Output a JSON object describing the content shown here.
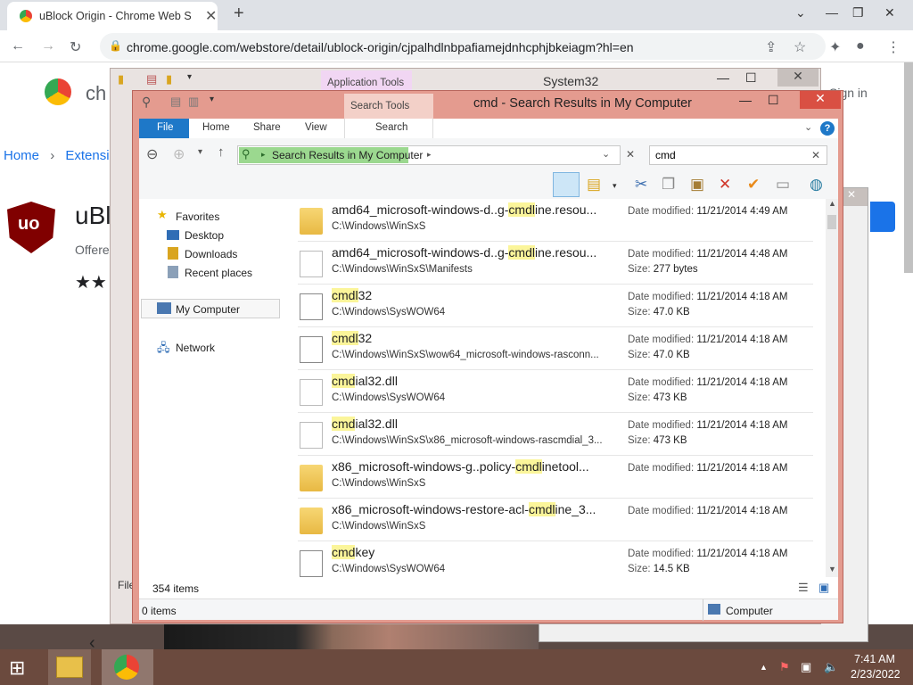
{
  "browser": {
    "tab_title": "uBlock Origin - Chrome Web Store",
    "new_tab_icon": "+",
    "url": "chrome.google.com/webstore/detail/ublock-origin/cjpalhdlnbpafiamejdnhcphjbkeiagm?hl=en"
  },
  "webpage": {
    "store_title_partial": "ch",
    "sign_in": "Sign in",
    "breadcrumb_home": "Home",
    "breadcrumb_sep": "›",
    "breadcrumb_ext": "Extensi",
    "ext_name_partial": "uBl",
    "ext_logo_text": "uo",
    "offered_partial": "Offere",
    "stars": "★★"
  },
  "background_window": {
    "title": "System32",
    "context_tab": "Application Tools",
    "status_partial": "File"
  },
  "explorer": {
    "title": "cmd - Search Results in My Computer",
    "context_tab": "Search Tools",
    "ribbon_tabs": {
      "file": "File",
      "home": "Home",
      "share": "Share",
      "view": "View",
      "search": "Search"
    },
    "address": "Search Results in My Computer",
    "search_value": "cmd",
    "nav": {
      "favorites": "Favorites",
      "desktop": "Desktop",
      "downloads": "Downloads",
      "recent": "Recent places",
      "my_computer": "My Computer",
      "network": "Network"
    },
    "date_label": "Date modified:",
    "size_label": "Size:",
    "results": [
      {
        "pre": "amd64_microsoft-windows-d..g-",
        "hit": "cmdl",
        "post": "ine.resou...",
        "path": "C:\\Windows\\WinSxS",
        "date": "11/21/2014 4:49 AM",
        "size": "",
        "icon": "folder"
      },
      {
        "pre": "amd64_microsoft-windows-d..g-",
        "hit": "cmdl",
        "post": "ine.resou...",
        "path": "C:\\Windows\\WinSxS\\Manifests",
        "date": "11/21/2014 4:48 AM",
        "size": "277 bytes",
        "icon": "document"
      },
      {
        "pre": "",
        "hit": "cmdl",
        "post": "32",
        "path": "C:\\Windows\\SysWOW64",
        "date": "11/21/2014 4:18 AM",
        "size": "47.0 KB",
        "icon": "executable"
      },
      {
        "pre": "",
        "hit": "cmdl",
        "post": "32",
        "path": "C:\\Windows\\WinSxS\\wow64_microsoft-windows-rasconn...",
        "date": "11/21/2014 4:18 AM",
        "size": "47.0 KB",
        "icon": "executable"
      },
      {
        "pre": "",
        "hit": "cmd",
        "post": "ial32.dll",
        "path": "C:\\Windows\\SysWOW64",
        "date": "11/21/2014 4:18 AM",
        "size": "473 KB",
        "icon": "dll"
      },
      {
        "pre": "",
        "hit": "cmd",
        "post": "ial32.dll",
        "path": "C:\\Windows\\WinSxS\\x86_microsoft-windows-rascmdial_3...",
        "date": "11/21/2014 4:18 AM",
        "size": "473 KB",
        "icon": "dll"
      },
      {
        "pre": "x86_microsoft-windows-g..policy-",
        "hit": "cmdl",
        "post": "inetool...",
        "path": "C:\\Windows\\WinSxS",
        "date": "11/21/2014 4:18 AM",
        "size": "",
        "icon": "folder"
      },
      {
        "pre": "x86_microsoft-windows-restore-acl-",
        "hit": "cmdl",
        "post": "ine_3...",
        "path": "C:\\Windows\\WinSxS",
        "date": "11/21/2014 4:18 AM",
        "size": "",
        "icon": "folder"
      },
      {
        "pre": "",
        "hit": "cmd",
        "post": "key",
        "path": "C:\\Windows\\SysWOW64",
        "date": "11/21/2014 4:18 AM",
        "size": "14.5 KB",
        "icon": "executable"
      }
    ],
    "item_count": "354 items",
    "selected_count": "0 items",
    "location": "Computer"
  },
  "taskbar": {
    "time": "7:41 AM",
    "date": "2/23/2022"
  },
  "colors": {
    "explorer_frame": "#e49b8f",
    "search_highlight": "#fbf59a",
    "file_tab": "#1e78c8",
    "taskbar": "#6b4a3e"
  }
}
